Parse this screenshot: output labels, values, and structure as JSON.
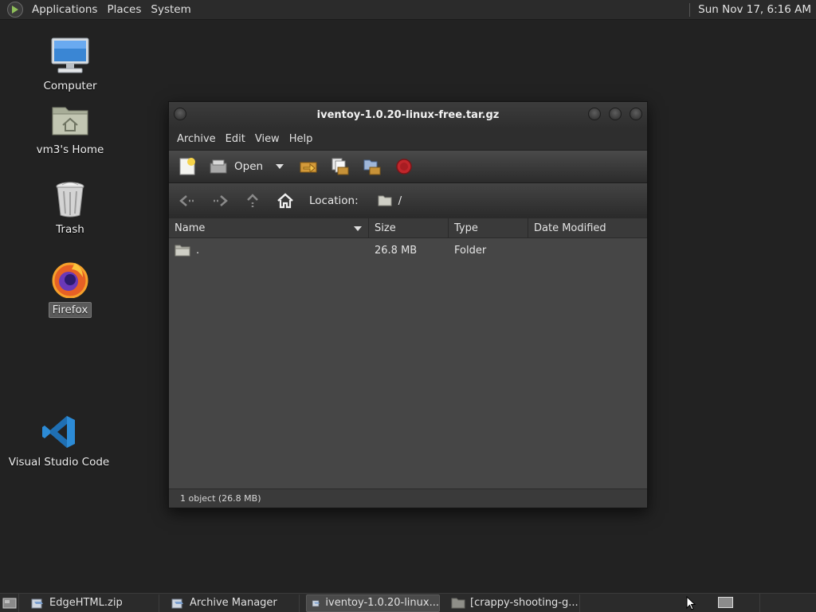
{
  "top_panel": {
    "menus": [
      "Applications",
      "Places",
      "System"
    ],
    "clock": "Sun Nov 17,  6:16 AM"
  },
  "desktop": {
    "icons": [
      {
        "label": "Computer",
        "icon": "computer-icon"
      },
      {
        "label": "vm3's Home",
        "icon": "home-folder-icon"
      },
      {
        "label": "Trash",
        "icon": "trash-icon"
      },
      {
        "label": "Firefox",
        "icon": "firefox-icon",
        "selected": true
      },
      {
        "label": "Visual Studio Code",
        "icon": "vscode-icon"
      }
    ]
  },
  "window": {
    "title": "iventoy-1.0.20-linux-free.tar.gz",
    "menu": [
      "Archive",
      "Edit",
      "View",
      "Help"
    ],
    "toolbar": {
      "open_label": "Open",
      "tools": [
        "new-archive-icon",
        "open-archive-icon",
        "extract-icon",
        "add-files-icon",
        "add-folder-icon",
        "stop-icon"
      ]
    },
    "location": {
      "label": "Location:",
      "path": "/"
    },
    "columns": [
      "Name",
      "Size",
      "Type",
      "Date Modified"
    ],
    "rows": [
      {
        "name": ".",
        "size": "26.8 MB",
        "type": "Folder",
        "date": ""
      }
    ],
    "status": "1 object (26.8 MB)"
  },
  "taskbar": {
    "tasks": [
      {
        "label": "EdgeHTML.zip",
        "active": false
      },
      {
        "label": "Archive Manager",
        "active": false
      },
      {
        "label": "iventoy-1.0.20-linux...",
        "active": true
      },
      {
        "label": "[crappy-shooting-g...",
        "active": false
      }
    ]
  },
  "colors": {
    "desktop_bg": "#222222",
    "panel_bg": "#2b2b2b",
    "window_bg": "#3a3a3a",
    "list_bg": "#464646",
    "vscode_blue": "#2c8bd6",
    "stop_red": "#c0262b"
  }
}
